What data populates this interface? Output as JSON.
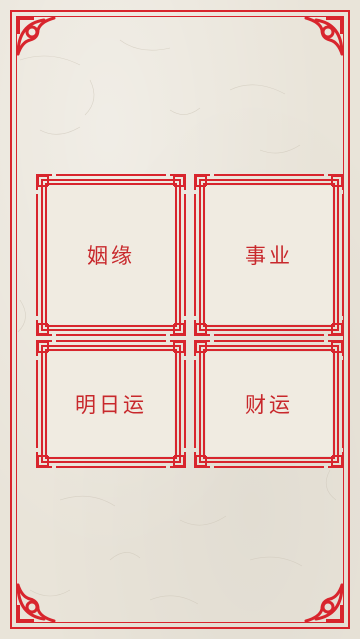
{
  "theme": {
    "accent": "#d8252d",
    "paper": "#e9e4d9",
    "tile_face": "#f0ebe1"
  },
  "menu": {
    "items": [
      {
        "label": "姻缘",
        "icon": "lattice-frame-icon"
      },
      {
        "label": "事业",
        "icon": "lattice-frame-icon"
      },
      {
        "label": "明日运",
        "icon": "lattice-frame-icon"
      },
      {
        "label": "财运",
        "icon": "lattice-frame-icon"
      }
    ]
  }
}
